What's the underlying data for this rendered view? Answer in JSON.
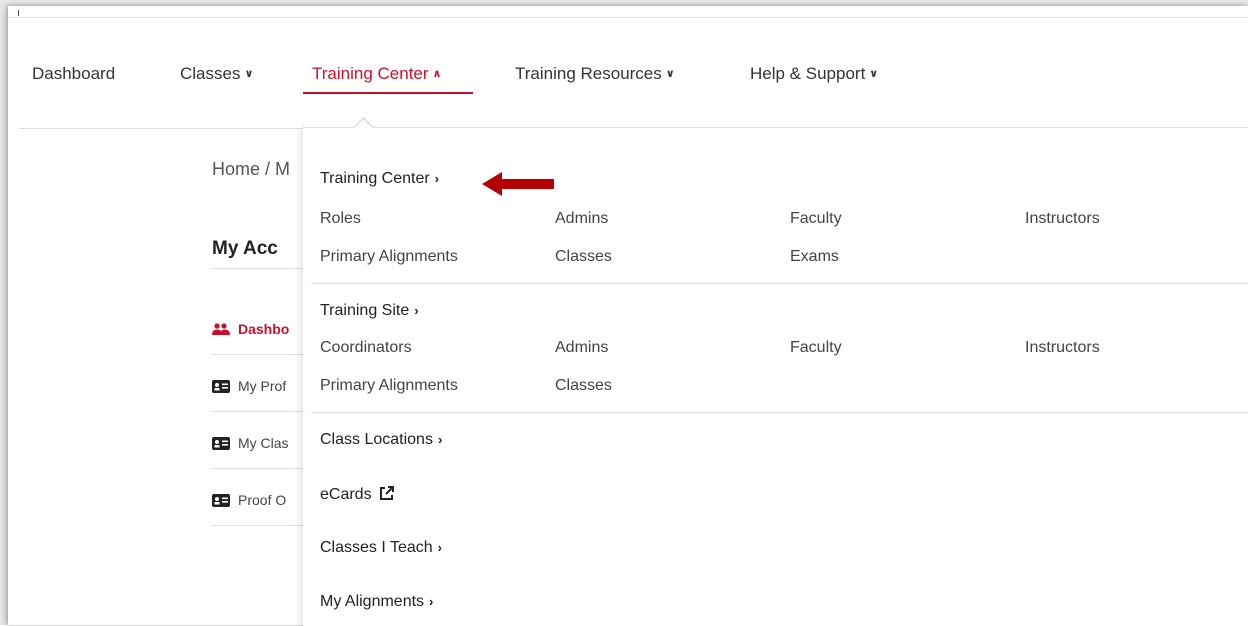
{
  "nav": {
    "items": [
      {
        "label": "Dashboard",
        "has_chevron": false
      },
      {
        "label": "Classes",
        "has_chevron": true,
        "chevron": "down"
      },
      {
        "label": "Training Center",
        "has_chevron": true,
        "chevron": "up",
        "active": true
      },
      {
        "label": "Training Resources",
        "has_chevron": true,
        "chevron": "down"
      },
      {
        "label": "Help & Support",
        "has_chevron": true,
        "chevron": "down"
      }
    ]
  },
  "page": {
    "breadcrumb": "Home / M",
    "account_title": "My Acc",
    "sidebar": [
      {
        "label": "Dashbo",
        "icon": "users-icon",
        "active": true
      },
      {
        "label": "My Prof",
        "icon": "id-card-icon"
      },
      {
        "label": "My Clas",
        "icon": "id-card-icon"
      },
      {
        "label": "Proof O",
        "icon": "id-card-icon"
      }
    ]
  },
  "dropdown": {
    "training_center": {
      "heading": "Training Center",
      "links": [
        "Roles",
        "Admins",
        "Faculty",
        "Instructors",
        "Primary Alignments",
        "Classes",
        "Exams"
      ]
    },
    "training_site": {
      "heading": "Training Site",
      "links": [
        "Coordinators",
        "Admins",
        "Faculty",
        "Instructors",
        "Primary Alignments",
        "Classes"
      ]
    },
    "class_locations": "Class Locations",
    "ecards": "eCards",
    "classes_i_teach": "Classes I Teach",
    "my_alignments": "My Alignments"
  },
  "colors": {
    "accent": "#c8102e",
    "text": "#333333",
    "arrow": "#b30000"
  }
}
